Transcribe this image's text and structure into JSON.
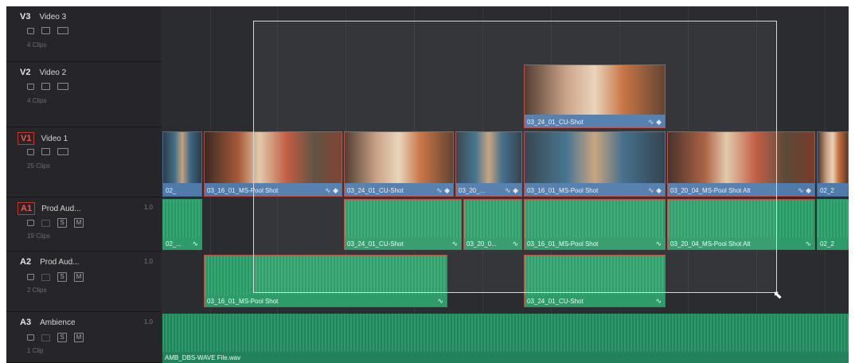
{
  "tracks": [
    {
      "code": "V3",
      "name": "Video 3",
      "clips": "4 Clips",
      "type": "video",
      "highlight": false
    },
    {
      "code": "V2",
      "name": "Video 2",
      "clips": "4 Clips",
      "type": "video",
      "highlight": false
    },
    {
      "code": "V1",
      "name": "Video 1",
      "clips": "25 Clips",
      "type": "video",
      "highlight": true
    },
    {
      "code": "A1",
      "name": "Prod Aud...",
      "clips": "19 Clips",
      "type": "audio",
      "level": "1.0",
      "highlight": true
    },
    {
      "code": "A2",
      "name": "Prod Aud...",
      "clips": "2 Clips",
      "type": "audio",
      "level": "1.0",
      "highlight": false
    },
    {
      "code": "A3",
      "name": "Ambience",
      "clips": "1 Clip",
      "type": "audio",
      "level": "1.0",
      "highlight": false
    }
  ],
  "clips": {
    "v2": [
      "03_24_01_CU-Shot"
    ],
    "v1": [
      "02_",
      "03_16_01_MS-Pool Shot",
      "03_24_01_CU-Shot",
      "03_20_...",
      "03_16_01_MS-Pool Shot",
      "03_20_04_MS-Pool Shot Alt",
      "02_2"
    ],
    "a1": [
      "02_...",
      "03_24_01_CU-Shot",
      "03_20_0...",
      "03_16_01_MS-Pool Shot",
      "03_20_04_MS-Pool Shot Alt",
      "02_2"
    ],
    "a2": [
      "03_16_01_MS-Pool Shot",
      "03_24_01_CU-Shot"
    ],
    "a3": [
      "AMB_DBS-WAVE File.wav"
    ]
  },
  "icons": [
    "lock-icon",
    "monitor-icon",
    "film-icon",
    "solo-icon",
    "mute-icon",
    "link-icon",
    "fx-icon",
    "pointer-cursor-icon"
  ],
  "colors": {
    "selected_border": "#c0463f",
    "video_clip": "#4f7bab",
    "audio_clip": "#2f9a6a",
    "ambience": "#23825b"
  }
}
